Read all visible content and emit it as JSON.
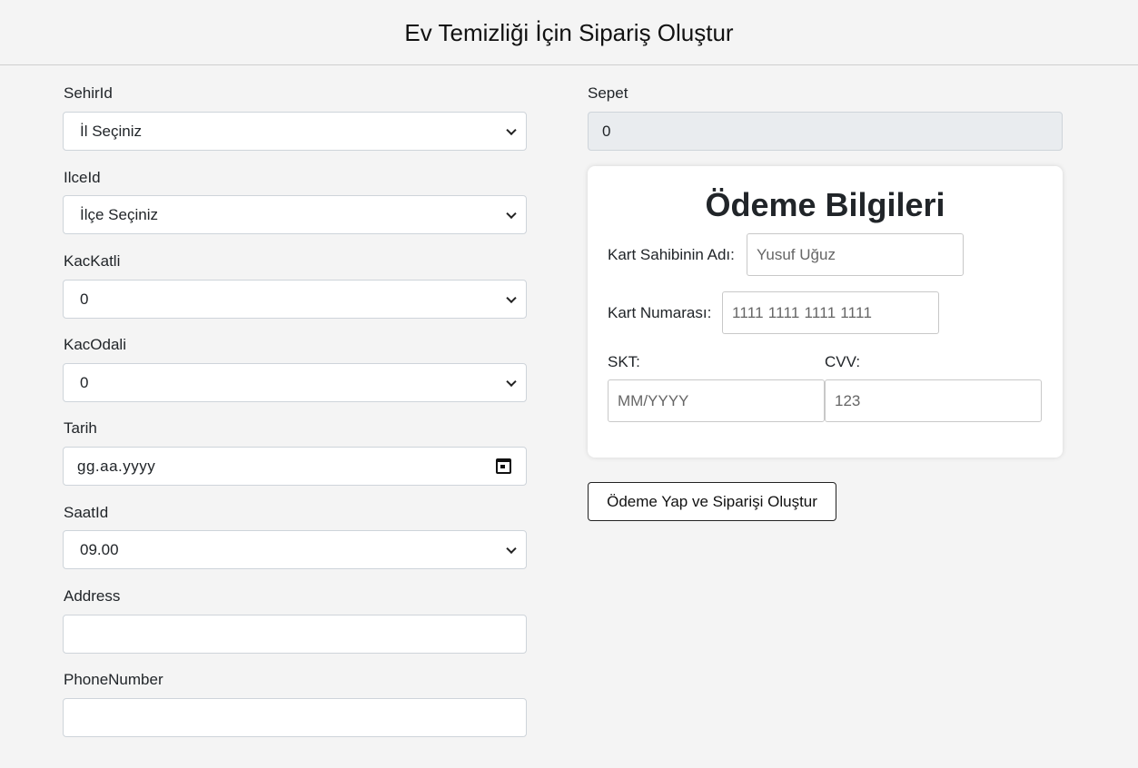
{
  "header": {
    "title": "Ev Temizliği İçin Sipariş Oluştur"
  },
  "form": {
    "sehir": {
      "label": "SehirId",
      "value": "İl Seçiniz"
    },
    "ilce": {
      "label": "IlceId",
      "value": "İlçe Seçiniz"
    },
    "kat": {
      "label": "KacKatli",
      "value": "0"
    },
    "oda": {
      "label": "KacOdali",
      "value": "0"
    },
    "tarih": {
      "label": "Tarih",
      "placeholder": "gg.aa.yyyy"
    },
    "saat": {
      "label": "SaatId",
      "value": "09.00"
    },
    "address": {
      "label": "Address",
      "value": ""
    },
    "phone": {
      "label": "PhoneNumber",
      "value": ""
    }
  },
  "basket": {
    "label": "Sepet",
    "value": "0"
  },
  "payment": {
    "title": "Ödeme Bilgileri",
    "card_holder": {
      "label": "Kart Sahibinin Adı:",
      "placeholder": "Yusuf Uğuz"
    },
    "card_number": {
      "label": "Kart Numarası:",
      "placeholder": "1111 1111 1111 1111"
    },
    "expiry": {
      "label": "SKT:",
      "placeholder": "MM/YYYY"
    },
    "cvv": {
      "label": "CVV:",
      "placeholder": "123"
    },
    "submit_label": "Ödeme Yap ve Siparişi Oluştur"
  },
  "icons": {
    "select": "chevron-down-icon",
    "date": "calendar-icon"
  }
}
